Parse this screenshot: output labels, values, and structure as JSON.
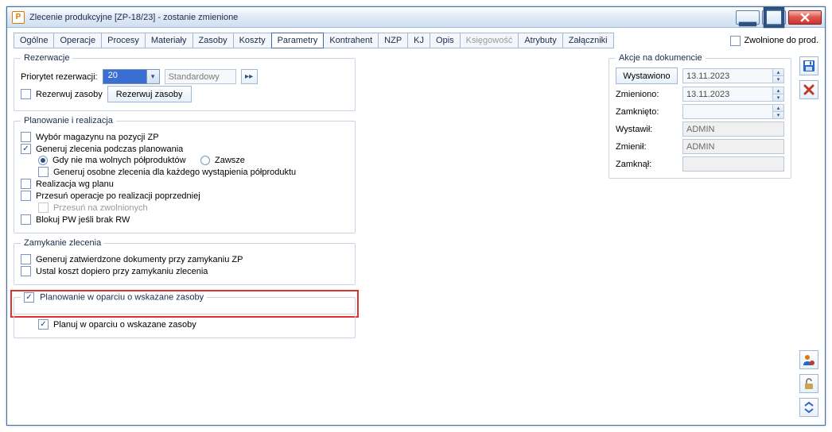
{
  "window": {
    "title": "Zlecenie produkcyjne  [ZP-18/23] - zostanie zmienione",
    "app_icon_letter": "P"
  },
  "release_checkbox": {
    "label": "Zwolnione do prod.",
    "checked": false
  },
  "tabs": [
    {
      "label": "Ogólne",
      "active": false
    },
    {
      "label": "Operacje",
      "active": false
    },
    {
      "label": "Procesy",
      "active": false
    },
    {
      "label": "Materiały",
      "active": false
    },
    {
      "label": "Zasoby",
      "active": false
    },
    {
      "label": "Koszty",
      "active": false
    },
    {
      "label": "Parametry",
      "active": true
    },
    {
      "label": "Kontrahent",
      "active": false
    },
    {
      "label": "NZP",
      "active": false
    },
    {
      "label": "KJ",
      "active": false
    },
    {
      "label": "Opis",
      "active": false
    },
    {
      "label": "Księgowość",
      "active": false,
      "disabled": true
    },
    {
      "label": "Atrybuty",
      "active": false
    },
    {
      "label": "Załączniki",
      "active": false
    }
  ],
  "reservations": {
    "legend": "Rezerwacje",
    "priority_label": "Priorytet rezerwacji:",
    "priority_value": "20",
    "priority_name_placeholder": "Standardowy",
    "reserve_resources_check": {
      "label": "Rezerwuj zasoby",
      "checked": false
    },
    "reserve_resources_button": "Rezerwuj zasoby"
  },
  "planning": {
    "legend": "Planowanie i realizacja",
    "storage_choice": {
      "label": "Wybór magazynu na pozycji ZP",
      "checked": false
    },
    "generate_orders": {
      "label": "Generuj zlecenia podczas planowania",
      "checked": true
    },
    "radio_no_free": "Gdy nie ma wolnych półproduktów",
    "radio_always": "Zawsze",
    "radio_selected": "no_free",
    "generate_separate": {
      "label": "Generuj osobne zlecenia dla każdego wystąpienia półproduktu",
      "checked": false
    },
    "realization_plan": {
      "label": "Realizacja wg planu",
      "checked": false
    },
    "shift_ops": {
      "label": "Przesuń operacje po realizacji poprzedniej",
      "checked": false
    },
    "shift_released": {
      "label": "Przesuń na zwolnionych",
      "checked": false,
      "disabled": true
    },
    "block_pw": {
      "label": "Blokuj PW jeśli brak RW",
      "checked": false
    }
  },
  "closing": {
    "legend": "Zamykanie zlecenia",
    "gen_docs": {
      "label": "Generuj zatwierdzone dokumenty przy zamykaniu ZP",
      "checked": false
    },
    "set_cost": {
      "label": "Ustal koszt dopiero przy zamykaniu zlecenia",
      "checked": false
    }
  },
  "planning_resources": {
    "legend": "Planowanie w oparciu o wskazane zasoby",
    "legend_checked": true,
    "plan": {
      "label": "Planuj w oparciu o wskazane zasoby",
      "checked": true
    }
  },
  "doc_actions": {
    "legend": "Akcje na dokumencie",
    "issued_button": "Wystawiono",
    "issued_date": "13.11.2023",
    "changed_label": "Zmieniono:",
    "changed_date": "13.11.2023",
    "closed_label": "Zamknięto:",
    "closed_date": "",
    "issued_by_label": "Wystawił:",
    "issued_by_value": "ADMIN",
    "changed_by_label": "Zmienił:",
    "changed_by_value": "ADMIN",
    "closed_by_label": "Zamknął:",
    "closed_by_value": ""
  },
  "colors": {
    "accent": "#3a6ea5",
    "highlight": "#e03030",
    "combo_bg": "#3a6ed0"
  }
}
